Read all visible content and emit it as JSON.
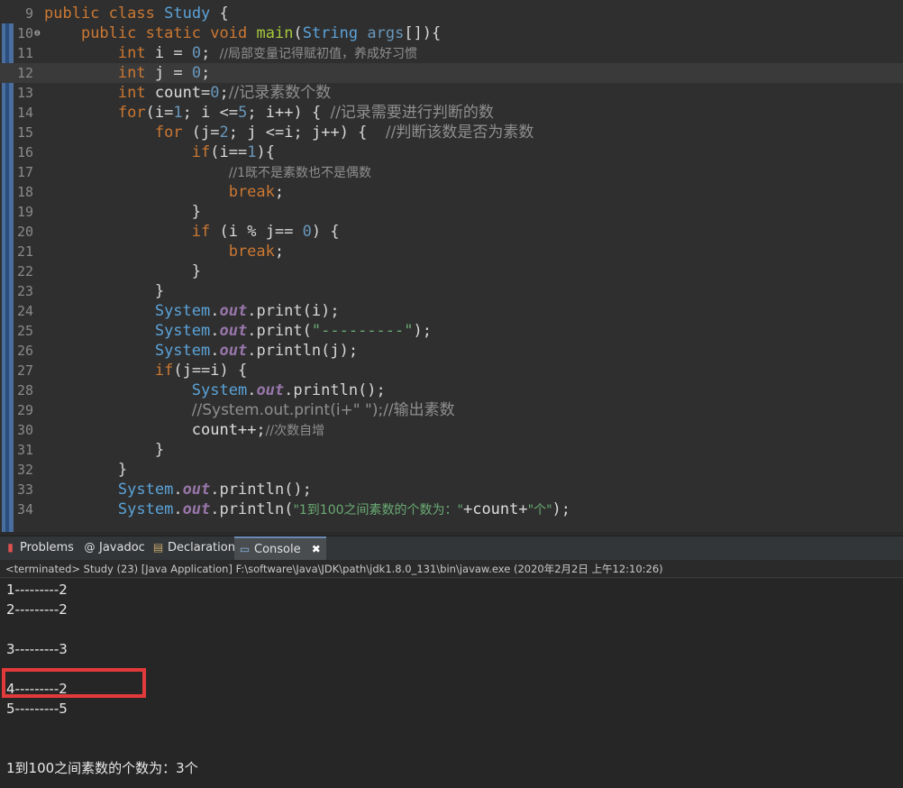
{
  "editor": {
    "lines": [
      {
        "no": "9"
      },
      {
        "no": "10"
      },
      {
        "no": "11"
      },
      {
        "no": "12"
      },
      {
        "no": "13"
      },
      {
        "no": "14"
      },
      {
        "no": "15"
      },
      {
        "no": "16"
      },
      {
        "no": "17"
      },
      {
        "no": "18"
      },
      {
        "no": "19"
      },
      {
        "no": "20"
      },
      {
        "no": "21"
      },
      {
        "no": "22"
      },
      {
        "no": "23"
      },
      {
        "no": "24"
      },
      {
        "no": "25"
      },
      {
        "no": "26"
      },
      {
        "no": "27"
      },
      {
        "no": "28"
      },
      {
        "no": "29"
      },
      {
        "no": "30"
      },
      {
        "no": "31"
      },
      {
        "no": "32"
      },
      {
        "no": "33"
      },
      {
        "no": "34"
      }
    ],
    "tokens": {
      "public": "public",
      "class": "class",
      "static": "static",
      "void": "void",
      "int": "int",
      "for": "for",
      "if": "if",
      "break": "break",
      "Study": "Study",
      "main": "main",
      "String": "String",
      "args": "args",
      "i": "i",
      "j": "j",
      "count": "count",
      "System": "System",
      "out": "out",
      "print": "print",
      "println": "println",
      "c11": "//局部变量记得赋初值，养成好习惯",
      "c13": "//记录素数个数",
      "c14": "//记录需要进行判断的数",
      "c15": "//判断该数是否为素数",
      "c17": "//1既不是素数也不是偶数",
      "c29": "//System.out.print(i+\" \");//输出素数",
      "c30": "//次数自增",
      "s25": "\"---------\"",
      "s34a": "\"1到100之间素数的个数为：\"",
      "s34b": "\"个\""
    }
  },
  "panel": {
    "tabs": [
      {
        "label": "Problems"
      },
      {
        "label": "Javadoc"
      },
      {
        "label": "Declaration"
      },
      {
        "label": "Console",
        "close": "✖"
      }
    ],
    "status": "<terminated> Study (23) [Java Application] F:\\software\\Java\\JDK\\path\\jdk1.8.0_131\\bin\\javaw.exe (2020年2月2日 上午12:10:26)",
    "output": [
      "1---------2",
      "2---------2",
      "3---------3",
      "4---------2",
      "5---------5",
      "1到100之间素数的个数为：3个"
    ]
  },
  "colors": {
    "keyword": "#cc7832",
    "number": "#6897bb",
    "comment": "#8f8f8f",
    "string": "#6aab73",
    "highlight": "#e23a3a",
    "active_tab": "#4a4d50"
  }
}
